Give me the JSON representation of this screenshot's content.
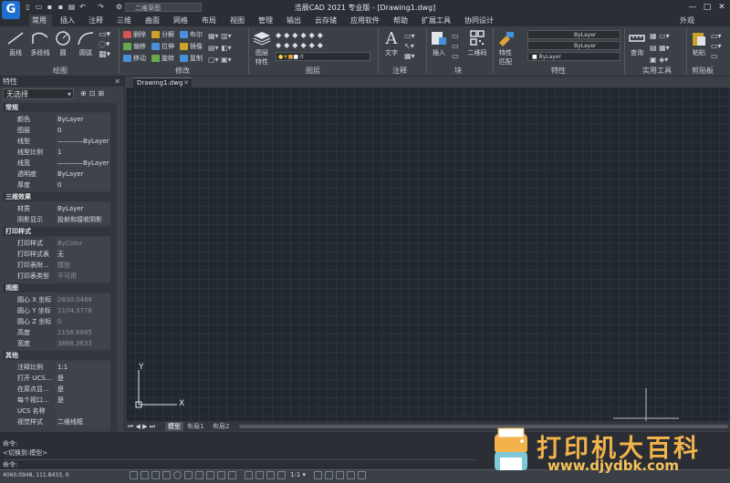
{
  "titlebar": {
    "workspace": "二维草图",
    "title": "浩辰CAD 2021 专业版 - [Drawing1.dwg]",
    "appearance": "外观"
  },
  "menus": [
    "常用",
    "插入",
    "注释",
    "三维",
    "曲面",
    "网格",
    "布局",
    "视图",
    "管理",
    "输出",
    "云存储",
    "应用软件",
    "帮助",
    "扩展工具",
    "协同设计"
  ],
  "ribbon": {
    "draw": {
      "line": "直线",
      "polyline": "多段线",
      "circle": "圆",
      "arc": "圆弧",
      "group": "绘图"
    },
    "modify": {
      "erase": "删除",
      "explode": "分解",
      "offset": "偏移",
      "stretch": "拉伸",
      "mirror": "镜像",
      "move": "移动",
      "rotate": "旋转",
      "copy": "复制",
      "boolean": "布尔",
      "group": "修改"
    },
    "layers": {
      "props_l1": "图层",
      "props_l2": "特性",
      "current": "0",
      "group": "图层"
    },
    "annotation": {
      "text": "文字",
      "group": "注释"
    },
    "block": {
      "insert": "插入",
      "qrcode": "二维码",
      "group": "块"
    },
    "properties": {
      "match_l1": "特性",
      "match_l2": "匹配",
      "bylayer1": "ByLayer",
      "bylayer2": "ByLayer",
      "bylayer3": "ByLayer",
      "group": "特性"
    },
    "utilities": {
      "query": "查询",
      "group": "实用工具"
    },
    "clipboard": {
      "paste": "粘贴",
      "group": "剪贴板"
    }
  },
  "properties_panel": {
    "title": "特性",
    "selection": "无选择",
    "sections": [
      {
        "name": "常规",
        "rows": [
          [
            "颜色",
            "ByLayer"
          ],
          [
            "图层",
            "0"
          ],
          [
            "线型",
            "————ByLayer"
          ],
          [
            "线型比例",
            "1"
          ],
          [
            "线宽",
            "————ByLayer"
          ],
          [
            "透明度",
            "ByLayer"
          ],
          [
            "厚度",
            "0"
          ]
        ]
      },
      {
        "name": "三维效果",
        "rows": [
          [
            "材质",
            "ByLayer"
          ],
          [
            "阴影显示",
            "投射和接收阴影"
          ]
        ]
      },
      {
        "name": "打印样式",
        "rows": [
          [
            "打印样式",
            "ByColor"
          ],
          [
            "打印样式表",
            "无"
          ],
          [
            "打印表附...",
            "模型"
          ],
          [
            "打印表类型",
            "不可用"
          ]
        ]
      },
      {
        "name": "视图",
        "rows": [
          [
            "圆心 X 坐标",
            "2630.0488"
          ],
          [
            "圆心 Y 坐标",
            "1104.3778"
          ],
          [
            "圆心 Z 坐标",
            "0"
          ],
          [
            "高度",
            "2158.6885"
          ],
          [
            "宽度",
            "3868.3633"
          ]
        ]
      },
      {
        "name": "其他",
        "rows": [
          [
            "注释比例",
            "1:1"
          ],
          [
            "打开 UCS...",
            "是"
          ],
          [
            "在原点显...",
            "是"
          ],
          [
            "每个视口...",
            "是"
          ],
          [
            "UCS 名称",
            ""
          ],
          [
            "视觉样式",
            "二维线框"
          ]
        ]
      }
    ]
  },
  "document": {
    "tab": "Drawing1.dwg",
    "layout_tabs": [
      "模型",
      "布局1",
      "布局2"
    ]
  },
  "command": {
    "line1": "命令:",
    "line2": "<切换到:模型>",
    "line3": "命令:"
  },
  "status": {
    "coords": "4060.0948, 111.8433, 0",
    "scale": "1:1"
  },
  "watermark": {
    "text": "打印机大百科",
    "url": "www.djydbk.com"
  },
  "colors": {
    "accent": "#1d6fd0",
    "canvas": "#212830",
    "panel": "#3b4047"
  }
}
